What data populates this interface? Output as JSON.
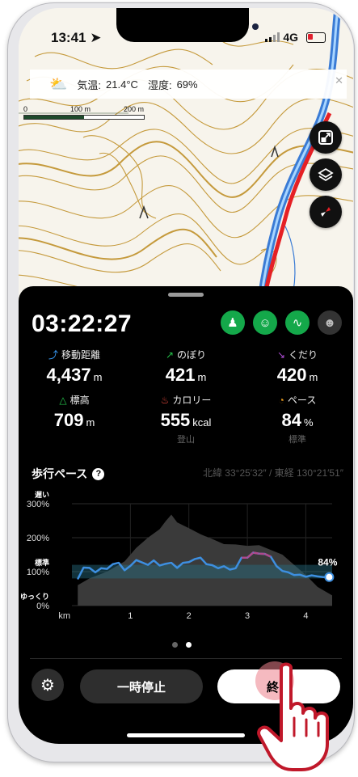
{
  "status_bar": {
    "time": "13:41",
    "network": "4G"
  },
  "weather": {
    "temp_label": "気温:",
    "temp_value": "21.4°C",
    "humidity_label": "湿度:",
    "humidity_value": "69%"
  },
  "scale": {
    "labels": [
      "0",
      "100 m",
      "200 m"
    ]
  },
  "map_buttons": [
    "expand-icon",
    "layers-icon",
    "compass-icon"
  ],
  "timer": "03:22:27",
  "modes": [
    {
      "icon": "hiker-group-icon",
      "active": true
    },
    {
      "icon": "face-icon",
      "active": true
    },
    {
      "icon": "route-icon",
      "active": true
    },
    {
      "icon": "people-icon",
      "active": false
    }
  ],
  "stats": {
    "distance": {
      "label": "移動距離",
      "value": "4,437",
      "unit": "m",
      "icon_color": "#3aa0ff"
    },
    "ascent": {
      "label": "のぼり",
      "value": "421",
      "unit": "m",
      "icon_color": "#24c24a"
    },
    "descent": {
      "label": "くだり",
      "value": "420",
      "unit": "m",
      "icon_color": "#b04dd8"
    },
    "altitude": {
      "label": "標高",
      "value": "709",
      "unit": "m",
      "icon_color": "#24c24a"
    },
    "calorie": {
      "label": "カロリー",
      "value": "555",
      "unit": "kcal",
      "sub": "登山",
      "icon_color": "#e9493d"
    },
    "pace": {
      "label": "ペース",
      "value": "84",
      "unit": "%",
      "sub": "標準",
      "icon_color": "#f0a020"
    }
  },
  "pace_section": {
    "title": "歩行ペース",
    "coords": "北緯 33°25′32″ / 東経 130°21′51″"
  },
  "chart_data": {
    "type": "line",
    "title": "",
    "xlabel": "km",
    "ylabel": "",
    "x_ticks": [
      "km",
      "1",
      "2",
      "3",
      "4"
    ],
    "y_ticks": [
      "0%",
      "100%",
      "200%",
      "300%"
    ],
    "y_tick_values": [
      0,
      100,
      200,
      300
    ],
    "y_labels": [
      "遅い",
      "標準",
      "ゆっくり"
    ],
    "xlim": [
      0,
      4.45
    ],
    "ylim": [
      0,
      300
    ],
    "current_label": "84%",
    "series": [
      {
        "x": [
          0.1,
          0.2,
          0.3,
          0.4,
          0.5,
          0.6,
          0.7,
          0.8,
          0.9,
          1.0,
          1.1,
          1.2,
          1.3,
          1.4,
          1.5,
          1.6,
          1.7,
          1.8,
          1.9,
          2.0,
          2.1,
          2.2,
          2.3,
          2.4,
          2.5,
          2.6,
          2.7,
          2.8,
          2.9,
          3.0,
          3.1,
          3.2,
          3.3,
          3.4,
          3.5,
          3.6,
          3.7,
          3.8,
          3.9,
          4.0,
          4.1,
          4.2,
          4.3,
          4.4
        ],
        "values": [
          78,
          112,
          111,
          98,
          110,
          108,
          122,
          126,
          104,
          117,
          134,
          127,
          120,
          133,
          118,
          123,
          126,
          111,
          126,
          128,
          137,
          141,
          122,
          119,
          110,
          116,
          106,
          110,
          141,
          141,
          156,
          153,
          152,
          144,
          116,
          102,
          98,
          90,
          91,
          85,
          89,
          86,
          84,
          84
        ]
      }
    ],
    "elevation_profile": {
      "x": [
        0.1,
        0.3,
        0.6,
        0.9,
        1.1,
        1.3,
        1.5,
        1.6,
        1.7,
        1.8,
        2.0,
        2.2,
        2.4,
        2.6,
        2.8,
        3.0,
        3.2,
        3.4,
        3.6,
        3.8,
        4.0,
        4.2,
        4.45
      ],
      "values": [
        60,
        80,
        100,
        130,
        170,
        200,
        225,
        248,
        268,
        245,
        228,
        210,
        196,
        181,
        180,
        176,
        178,
        164,
        150,
        120,
        90,
        55,
        30
      ]
    },
    "baseline_band": [
      80,
      120
    ]
  },
  "buttons": {
    "pause": "一時停止",
    "end": "終了"
  },
  "page_dots": [
    false,
    true
  ]
}
